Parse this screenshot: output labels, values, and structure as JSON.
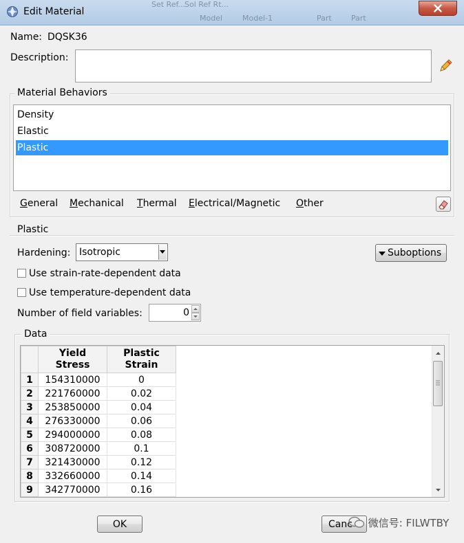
{
  "window": {
    "title": "Edit Material",
    "background_text": [
      "Set Ref...",
      "Sol Ref Rt...",
      "Model",
      "Model-1",
      "Part",
      "Part"
    ]
  },
  "form": {
    "name_label": "Name:",
    "name_value": "DQSK36",
    "description_label": "Description:",
    "description_value": ""
  },
  "behaviors": {
    "group_title": "Material Behaviors",
    "items": [
      {
        "label": "Density",
        "selected": false
      },
      {
        "label": "Elastic",
        "selected": false
      },
      {
        "label": "Plastic",
        "selected": true
      }
    ],
    "menus": [
      {
        "first": "G",
        "rest": "eneral"
      },
      {
        "first": "M",
        "rest": "echanical"
      },
      {
        "first": "T",
        "rest": "hermal"
      },
      {
        "first": "E",
        "rest": "lectrical/Magnetic"
      },
      {
        "first": "O",
        "rest": "ther"
      }
    ]
  },
  "plastic": {
    "section_title": "Plastic",
    "hardening_label": "Hardening:",
    "hardening_value": "Isotropic",
    "suboptions_label": "Suboptions",
    "strain_rate_label": "Use strain-rate-dependent data",
    "strain_rate_checked": false,
    "temperature_label": "Use temperature-dependent data",
    "temperature_checked": false,
    "field_vars_label": "Number of field variables:",
    "field_vars_value": "0",
    "data_title": "Data",
    "columns": [
      {
        "line1": "Yield",
        "line2": "Stress"
      },
      {
        "line1": "Plastic",
        "line2": "Strain"
      }
    ],
    "rows": [
      {
        "num": "1",
        "yield_stress": "154310000",
        "plastic_strain": "0"
      },
      {
        "num": "2",
        "yield_stress": "221760000",
        "plastic_strain": "0.02"
      },
      {
        "num": "3",
        "yield_stress": "253850000",
        "plastic_strain": "0.04"
      },
      {
        "num": "4",
        "yield_stress": "276330000",
        "plastic_strain": "0.06"
      },
      {
        "num": "5",
        "yield_stress": "294000000",
        "plastic_strain": "0.08"
      },
      {
        "num": "6",
        "yield_stress": "308720000",
        "plastic_strain": "0.1"
      },
      {
        "num": "7",
        "yield_stress": "321430000",
        "plastic_strain": "0.12"
      },
      {
        "num": "8",
        "yield_stress": "332660000",
        "plastic_strain": "0.14"
      },
      {
        "num": "9",
        "yield_stress": "342770000",
        "plastic_strain": "0.16"
      }
    ]
  },
  "buttons": {
    "ok": "OK",
    "cancel": "Canc"
  },
  "watermark": "微信号: FILWTBY",
  "colors": {
    "selection": "#3399ff",
    "titlebar": "#c9dbee",
    "close_button": "#c75a45"
  }
}
